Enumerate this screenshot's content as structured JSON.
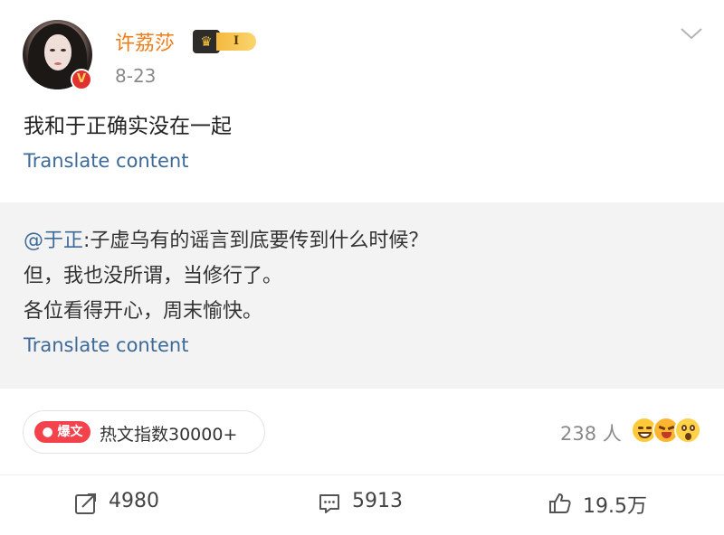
{
  "user": {
    "name": "许荔莎",
    "vip_level": "I",
    "verified_mark": "V",
    "time": "8-23"
  },
  "post": {
    "text": "我和于正确实没在一起",
    "translate_label": "Translate content"
  },
  "repost": {
    "mention": "@于正",
    "line1_rest": ":子虚乌有的谣言到底要传到什么时候？",
    "line2": "但，我也没所谓，当修行了。",
    "line3": "各位看得开心，周末愉快。",
    "translate_label": "Translate content"
  },
  "hot": {
    "tag": "爆文",
    "index_text": "热文指数30000+"
  },
  "reactions": {
    "count_text": "238 人",
    "emojis": [
      "grinning-face-icon",
      "laughing-tears-face-icon",
      "surprised-face-icon"
    ]
  },
  "actions": {
    "repost_count": "4980",
    "comment_count": "5913",
    "like_count": "19.5万"
  },
  "colors": {
    "username": "#f07d19",
    "link": "#3d6a99",
    "hot_tag": "#f3424b",
    "repost_bg": "#f3f3f3"
  }
}
